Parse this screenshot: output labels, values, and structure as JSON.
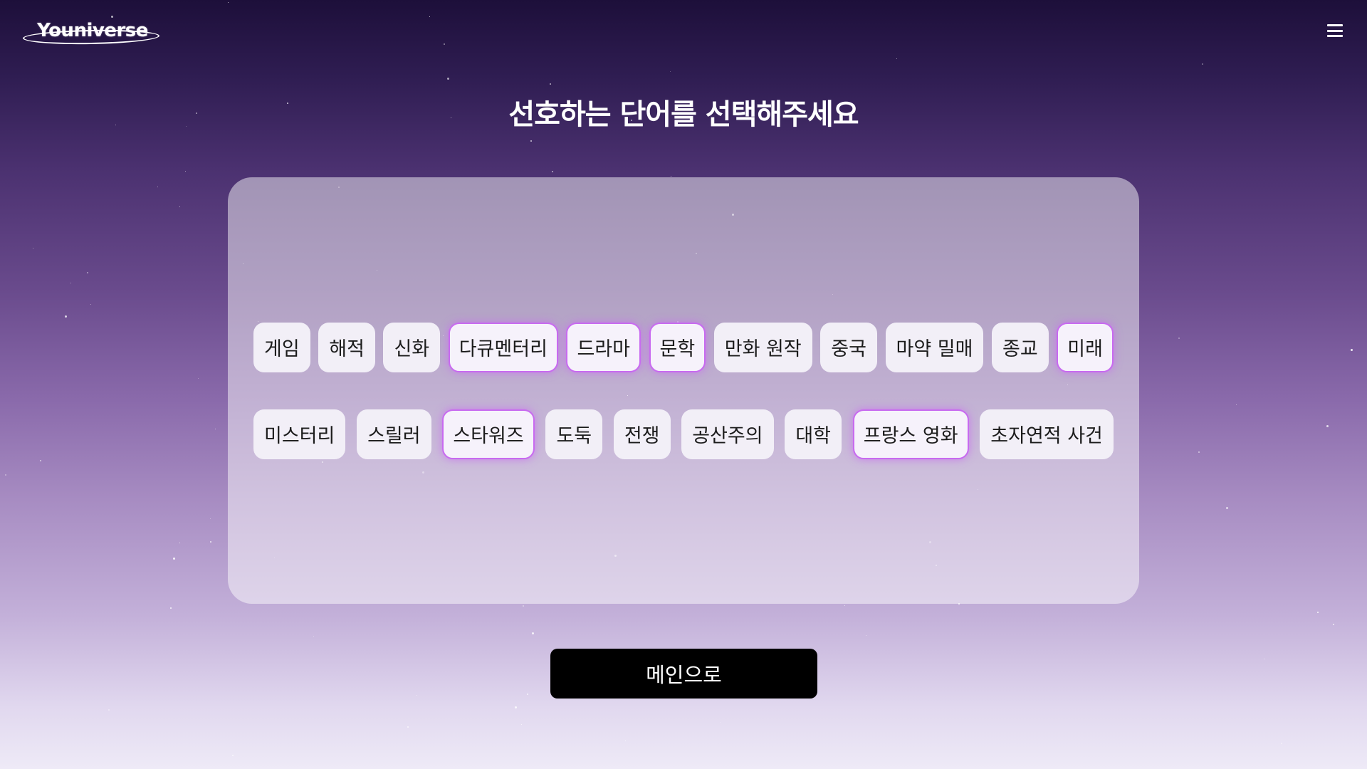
{
  "header": {
    "logo_text": "Youniverse",
    "menu_icon": "hamburger-menu-icon"
  },
  "page": {
    "title": "선호하는 단어를 선택해주세요"
  },
  "keywords": {
    "row1": [
      {
        "label": "게임",
        "selected": false
      },
      {
        "label": "해적",
        "selected": false
      },
      {
        "label": "신화",
        "selected": false
      },
      {
        "label": "다큐멘터리",
        "selected": true
      },
      {
        "label": "드라마",
        "selected": true
      },
      {
        "label": "문학",
        "selected": true
      },
      {
        "label": "만화 원작",
        "selected": false
      },
      {
        "label": "중국",
        "selected": false
      },
      {
        "label": "마약 밀매",
        "selected": false
      },
      {
        "label": "종교",
        "selected": false
      },
      {
        "label": "미래",
        "selected": true
      }
    ],
    "row2": [
      {
        "label": "미스터리",
        "selected": false
      },
      {
        "label": "스릴러",
        "selected": false
      },
      {
        "label": "스타워즈",
        "selected": true
      },
      {
        "label": "도둑",
        "selected": false
      },
      {
        "label": "전쟁",
        "selected": false
      },
      {
        "label": "공산주의",
        "selected": false
      },
      {
        "label": "대학",
        "selected": false
      },
      {
        "label": "프랑스 영화",
        "selected": true
      },
      {
        "label": "초자연적 사건",
        "selected": false
      }
    ]
  },
  "actions": {
    "main_button_label": "메인으로"
  },
  "colors": {
    "selected_border": "#c86af0",
    "chip_background": "#f2eff7",
    "button_background": "#000000"
  }
}
